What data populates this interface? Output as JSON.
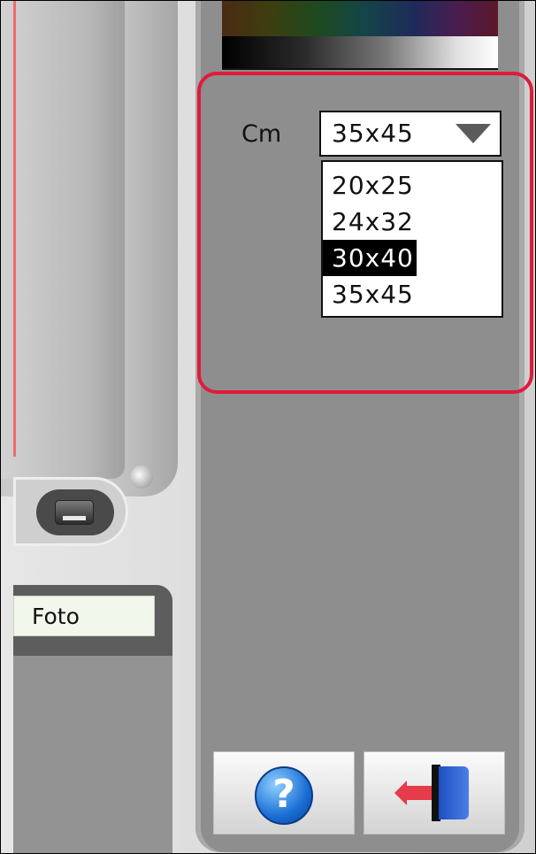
{
  "size_panel": {
    "unit_label": "Cm",
    "selected_value": "35x45",
    "options": [
      "20x25",
      "24x32",
      "30x40",
      "35x45"
    ],
    "highlighted_option": "30x40"
  },
  "left_panel": {
    "tab_label": "Foto"
  },
  "colors": {
    "highlight_border": "#e11a3a",
    "panel_gray": "#8e8e8e"
  },
  "icons": {
    "help": "help-icon",
    "exit": "exit-icon"
  }
}
